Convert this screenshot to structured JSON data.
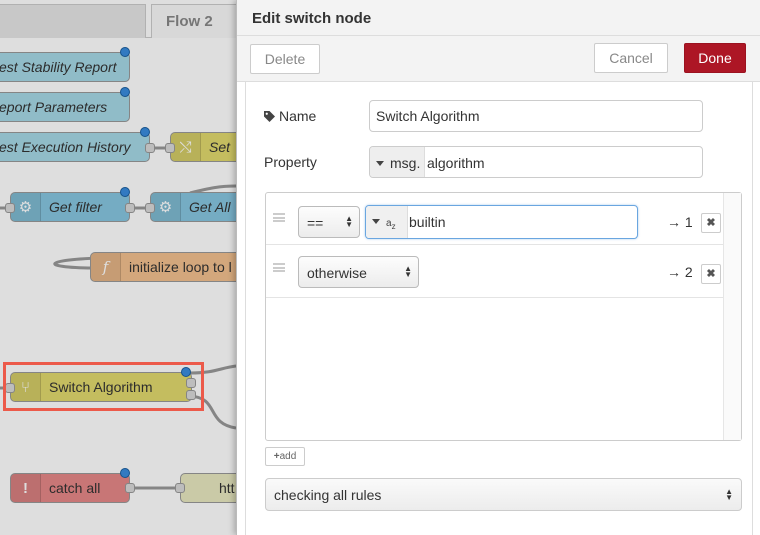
{
  "workspace": {
    "tabs": [
      {
        "label": ""
      },
      {
        "label": "Flow 2"
      }
    ],
    "nodes": [
      {
        "label": "est Stability Report"
      },
      {
        "label": "eport Parameters"
      },
      {
        "label": "est Execution History"
      },
      {
        "label": "Set"
      },
      {
        "label": "Get filter"
      },
      {
        "label": "Get All"
      },
      {
        "label": "initialize loop to l"
      },
      {
        "label": "Switch Algorithm"
      },
      {
        "label": "catch all"
      },
      {
        "label": "htt"
      }
    ]
  },
  "tray": {
    "title": "Edit switch node",
    "delete_label": "Delete",
    "cancel_label": "Cancel",
    "done_label": "Done",
    "name_label": "Name",
    "name_value": "Switch Algorithm",
    "property_label": "Property",
    "property_prefix": "msg.",
    "property_value": "algorithm",
    "rules": [
      {
        "operator": "==",
        "value_type_icon": "az",
        "value": "builtin",
        "output": "→ 1",
        "remove": "✖"
      },
      {
        "operator": "otherwise",
        "output": "→ 2",
        "remove": "✖"
      }
    ],
    "add_label": "add",
    "check_mode": "checking all rules"
  },
  "colors": {
    "done": "#ad1625",
    "highlight": "#ec5a4a",
    "status_dot": "#3a8dde"
  }
}
